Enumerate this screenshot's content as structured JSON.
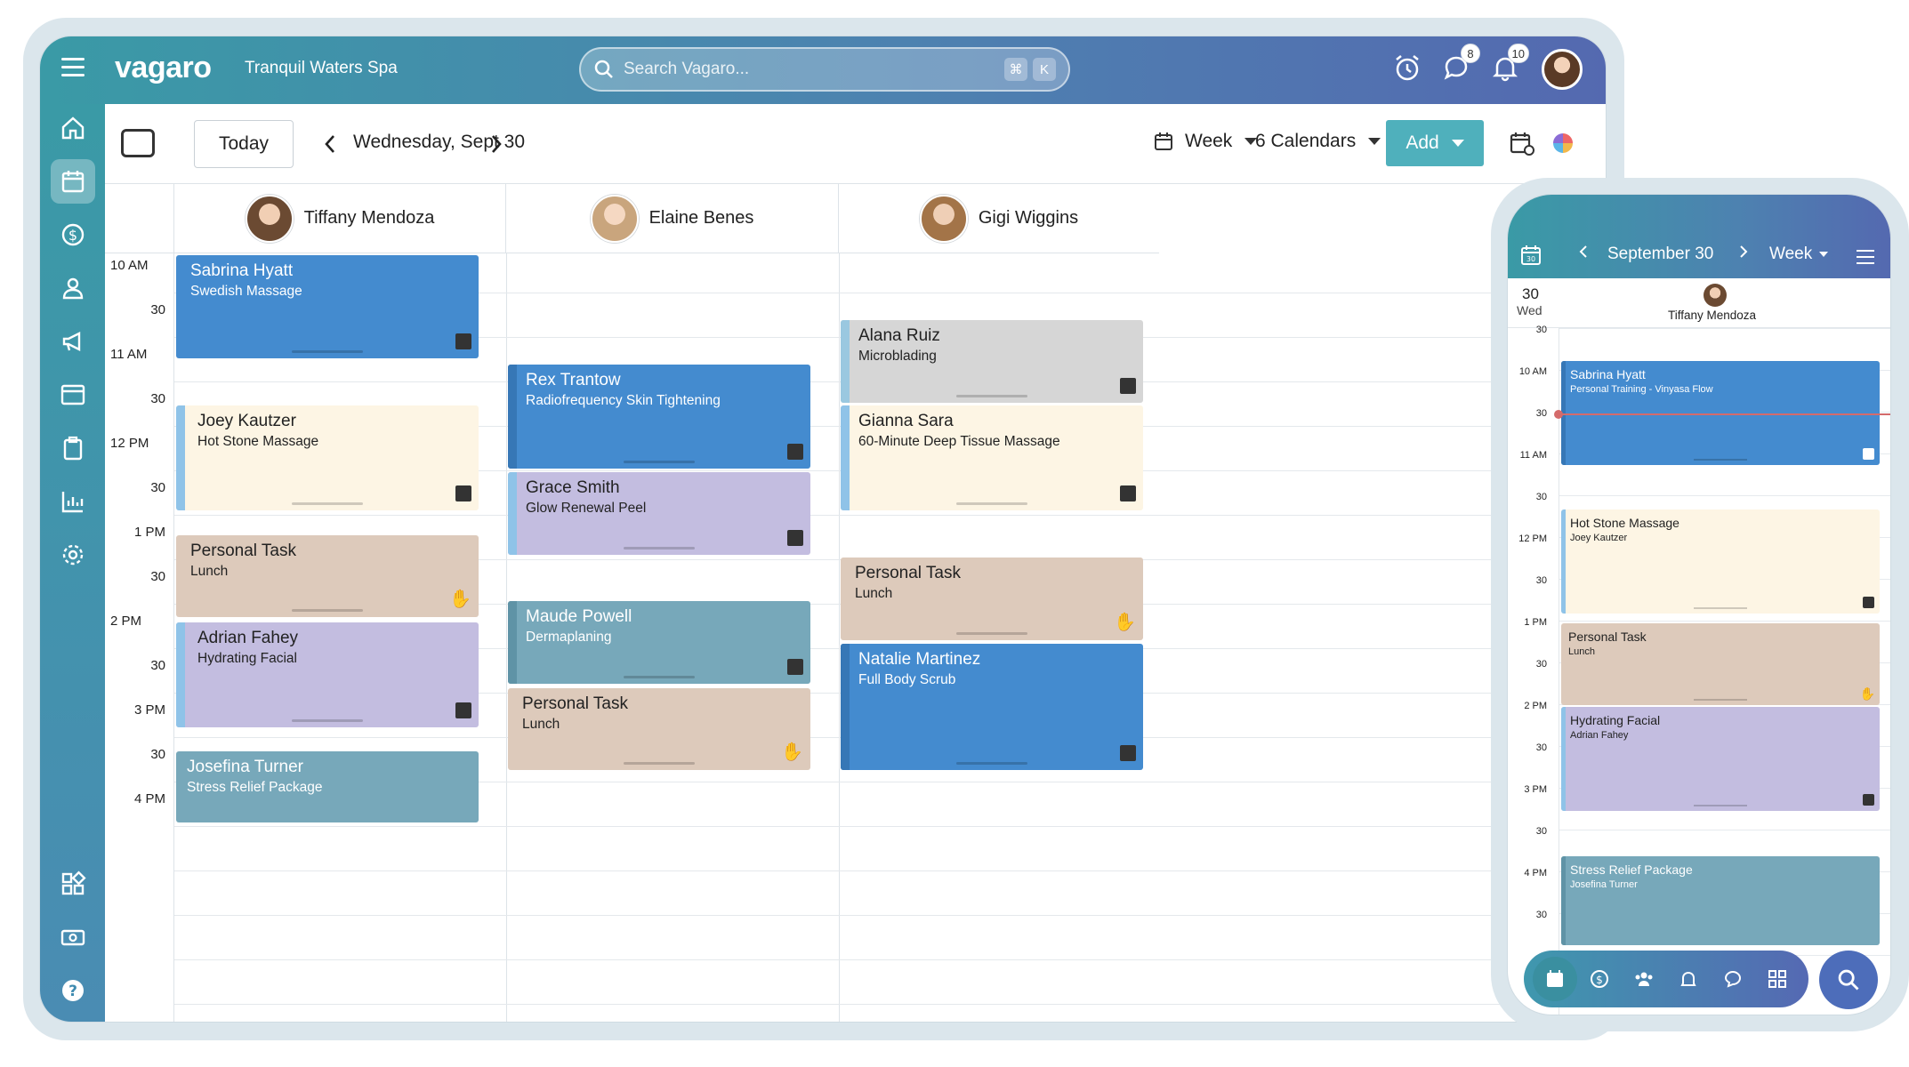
{
  "app": {
    "logo": "vagaro",
    "business": "Tranquil Waters Spa"
  },
  "search": {
    "placeholder": "Search Vagaro...",
    "kbd1": "⌘",
    "kbd2": "K"
  },
  "badges": {
    "messages": "8",
    "notifications": "10"
  },
  "toolbar": {
    "today": "Today",
    "date": "Wednesday, Sept 30",
    "view": "Week",
    "calendars": "6 Calendars",
    "add": "Add"
  },
  "staff": [
    {
      "name": "Tiffany Mendoza"
    },
    {
      "name": "Elaine Benes"
    },
    {
      "name": "Gigi Wiggins"
    }
  ],
  "times": [
    "10 AM",
    "30",
    "11 AM",
    "30",
    "12 PM",
    "30",
    "1 PM",
    "30",
    "2 PM",
    "30",
    "3 PM",
    "30",
    "4 PM"
  ],
  "appointments": {
    "col1": [
      {
        "name": "Sabrina Hyatt",
        "service": "Swedish Massage"
      },
      {
        "name": "Joey Kautzer",
        "service": "Hot Stone Massage"
      },
      {
        "name": "Personal Task",
        "service": "Lunch"
      },
      {
        "name": "Adrian Fahey",
        "service": "Hydrating Facial"
      },
      {
        "name": "Josefina Turner",
        "service": "Stress Relief Package"
      }
    ],
    "col2": [
      {
        "name": "Rex Trantow",
        "service": "Radiofrequency Skin Tightening"
      },
      {
        "name": "Grace Smith",
        "service": "Glow Renewal Peel"
      },
      {
        "name": "Maude Powell",
        "service": "Dermaplaning"
      },
      {
        "name": "Personal Task",
        "service": "Lunch"
      }
    ],
    "col3": [
      {
        "name": "Alana Ruiz",
        "service": "Microblading"
      },
      {
        "name": "Gianna Sara",
        "service": "60-Minute Deep Tissue Massage"
      },
      {
        "name": "Personal Task",
        "service": "Lunch"
      },
      {
        "name": "Natalie Martinez",
        "service": "Full Body Scrub"
      }
    ]
  },
  "phone": {
    "month": "September 30",
    "view": "Week",
    "day_num": "30",
    "day_name": "Wed",
    "staff": "Tiffany Mendoza",
    "times": [
      "30",
      "10 AM",
      "30",
      "11 AM",
      "30",
      "12 PM",
      "30",
      "1 PM",
      "30",
      "2 PM",
      "30",
      "3 PM",
      "30",
      "4 PM",
      "30"
    ],
    "appointments": [
      {
        "name": "Sabrina Hyatt",
        "service": "Personal Training - Vinyasa Flow"
      },
      {
        "name": "Hot Stone Massage",
        "service": "Joey Kautzer"
      },
      {
        "name": "Personal Task",
        "service": "Lunch"
      },
      {
        "name": "Hydrating Facial",
        "service": "Adrian Fahey"
      },
      {
        "name": "Stress Relief Package",
        "service": "Josefina Turner"
      }
    ]
  },
  "colors": {
    "accent": "#4fb0bc",
    "appt_blue": "#448bcf",
    "appt_teal": "#77a8ba",
    "appt_lavender": "#c3bde0",
    "appt_tan": "#ddcabb",
    "appt_cream": "#fdf5e4",
    "appt_grey": "#d6d6d6"
  }
}
